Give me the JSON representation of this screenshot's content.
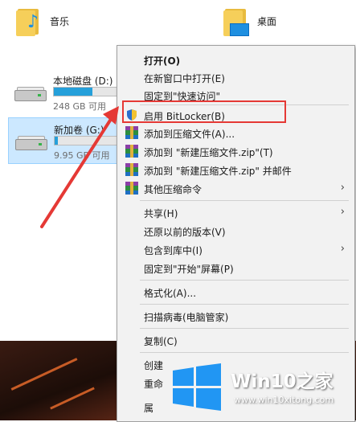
{
  "explorer": {
    "folders": [
      {
        "label": "音乐",
        "icon": "music-folder-icon"
      },
      {
        "label": "桌面",
        "icon": "desktop-folder-icon"
      }
    ],
    "drives": [
      {
        "name": "本地磁盘 (D:)",
        "free": "248 GB 可用",
        "used_fraction": 0.62,
        "selected": false
      },
      {
        "name": "新加卷 (G:)",
        "free": "9.95 GB 可用",
        "used_fraction": 0.05,
        "selected": true
      }
    ]
  },
  "context_menu": {
    "open": "打开(O)",
    "open_new_window": "在新窗口中打开(E)",
    "pin_quick_access": "固定到\"快速访问\"",
    "enable_bitlocker": "启用 BitLocker(B)",
    "add_to_archive": "添加到压缩文件(A)...",
    "add_to_zip": "添加到 \"新建压缩文件.zip\"(T)",
    "add_to_zip_email": "添加到 \"新建压缩文件.zip\" 并邮件",
    "other_compress": "其他压缩命令",
    "share": "共享(H)",
    "restore_previous": "还原以前的版本(V)",
    "include_library": "包含到库中(I)",
    "pin_start": "固定到\"开始\"屏幕(P)",
    "format": "格式化(A)...",
    "scan_virus": "扫描病毒(电脑管家)",
    "copy": "复制(C)",
    "create_shortcut": "创建",
    "rename": "重命",
    "properties": "属",
    "submenu_arrow": "›"
  },
  "colors": {
    "highlight_box": "#e53935",
    "arrow": "#e53935",
    "selection": "#cce8ff"
  },
  "watermark": {
    "brand": "Win10之家",
    "site": "www.win10xitong.com"
  }
}
